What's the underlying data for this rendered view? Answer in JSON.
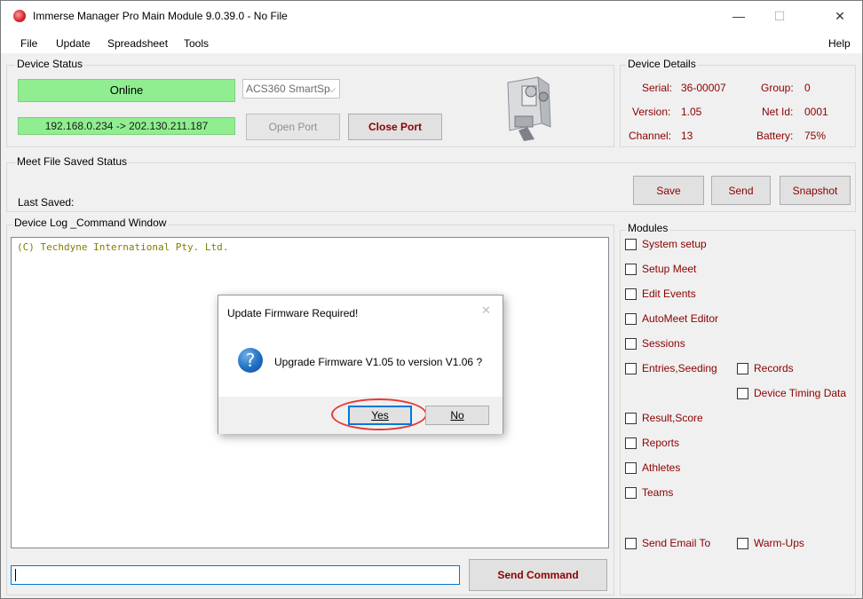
{
  "window": {
    "title": "Immerse Manager Pro Main Module 9.0.39.0 - No File",
    "minimize": "—",
    "maximize": "☐",
    "close": "✕"
  },
  "menu": {
    "items": [
      "File",
      "Update",
      "Spreadsheet",
      "Tools"
    ],
    "help": "Help"
  },
  "device_status": {
    "title": "Device Status",
    "status": "Online",
    "device_select": "ACS360 SmartSp",
    "address": "192.168.0.234 -> 202.130.211.187",
    "open_port": "Open Port",
    "close_port": "Close Port"
  },
  "device_details": {
    "title": "Device Details",
    "serial_label": "Serial:",
    "serial_value": "36-00007",
    "group_label": "Group:",
    "group_value": "0",
    "version_label": "Version:",
    "version_value": "1.05",
    "netid_label": "Net Id:",
    "netid_value": "0001",
    "channel_label": "Channel:",
    "channel_value": "13",
    "battery_label": "Battery:",
    "battery_value": "75%"
  },
  "meet_file": {
    "title": "Meet File Saved Status",
    "last_saved": "Last Saved:",
    "save": "Save",
    "send": "Send",
    "snapshot": "Snapshot"
  },
  "device_log": {
    "title": "Device Log _Command Window",
    "log_text": "(C) Techdyne International Pty. Ltd.",
    "input_value": "",
    "send_command": "Send Command"
  },
  "modules": {
    "title": "Modules",
    "items": {
      "system_setup": "System setup",
      "setup_meet": "Setup Meet",
      "edit_events": "Edit Events",
      "automeet_editor": "AutoMeet Editor",
      "sessions": "Sessions",
      "entries_seeding": "Entries,Seeding",
      "records": "Records",
      "device_timing": "Device Timing Data",
      "result_score": "Result,Score",
      "reports": "Reports",
      "athletes": "Athletes",
      "teams": "Teams",
      "send_email": "Send Email To",
      "warm_ups": "Warm-Ups"
    }
  },
  "dialog": {
    "title": "Update Firmware Required!",
    "message": "Upgrade Firmware V1.05 to version V1.06 ?",
    "yes": "Yes",
    "no": "No",
    "close": "✕",
    "icon": "?"
  }
}
